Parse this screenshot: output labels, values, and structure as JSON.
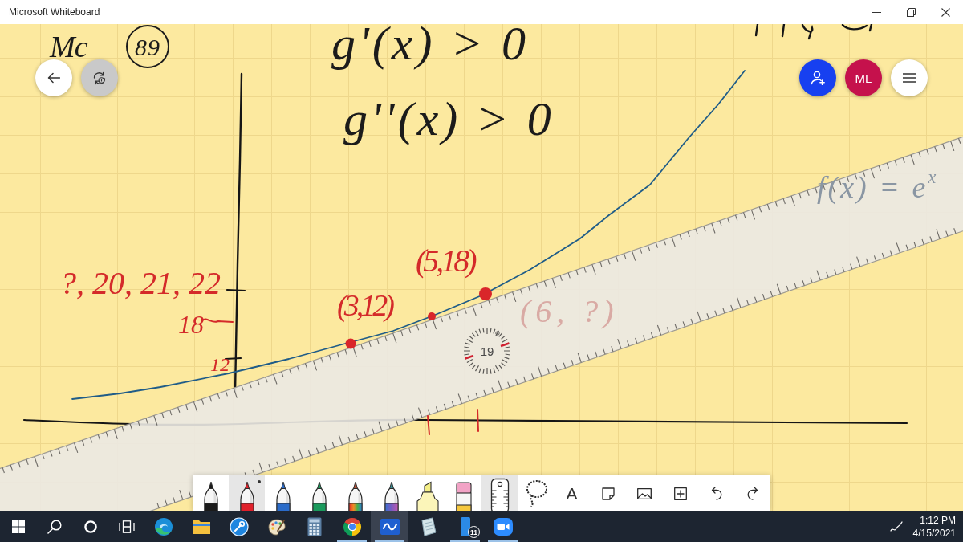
{
  "window": {
    "title": "Microsoft Whiteboard"
  },
  "board": {
    "ink_texts": [
      {
        "text": "Mc",
        "color": "#1b1b1b",
        "circled": false
      },
      {
        "text": "89",
        "color": "#1b1b1b",
        "circled": true
      },
      {
        "text": "g'(x) > 0",
        "color": "#1b1b1b",
        "circled": false
      },
      {
        "text": "g''(x) > 0",
        "color": "#1b1b1b",
        "circled": false
      },
      {
        "text": "f(x) = e$^{x}$",
        "color": "#8a96a3",
        "circled": false
      },
      {
        "text": "(5,18)",
        "color": "#d42a2a",
        "circled": false
      },
      {
        "text": "?, 20, 21, 22",
        "color": "#d42a2a",
        "circled": false
      },
      {
        "text": "18",
        "color": "#d42a2a",
        "circled": false
      },
      {
        "text": "(3,12)",
        "color": "#d42a2a",
        "circled": false
      },
      {
        "text": "(6, ?)",
        "color": "#d9aaa4",
        "circled": false
      },
      {
        "text": "12",
        "color": "#d42a2a",
        "circled": false
      }
    ],
    "angle_reading": "19",
    "participants": [
      {
        "initials": "ML",
        "color": "#c5114c"
      }
    ]
  },
  "toolbar": {
    "tools": [
      {
        "kind": "pen",
        "color": "#1b1b1b",
        "selected": false
      },
      {
        "kind": "pen",
        "color": "#e0212b",
        "selected": true
      },
      {
        "kind": "pen",
        "color": "#2a6bc9",
        "selected": false
      },
      {
        "kind": "pen",
        "color": "#1a9a5c",
        "selected": false
      },
      {
        "kind": "rainbow_pen",
        "selected": false
      },
      {
        "kind": "galaxy_pen",
        "selected": false
      },
      {
        "kind": "highlighter",
        "selected": false
      },
      {
        "kind": "eraser",
        "selected": false
      },
      {
        "kind": "ruler",
        "selected": true
      },
      {
        "kind": "lasso",
        "selected": false
      },
      {
        "kind": "text",
        "glyph": "A",
        "selected": false
      },
      {
        "kind": "sticky_note",
        "selected": false
      },
      {
        "kind": "image",
        "selected": false
      },
      {
        "kind": "insert",
        "selected": false
      },
      {
        "kind": "undo",
        "selected": false
      },
      {
        "kind": "redo",
        "selected": false
      }
    ]
  },
  "taskbar": {
    "apps": [
      {
        "kind": "start",
        "running": false,
        "selected": false
      },
      {
        "kind": "search",
        "running": false,
        "selected": false
      },
      {
        "kind": "cortana",
        "running": false,
        "selected": false
      },
      {
        "kind": "task_view",
        "running": false,
        "selected": false
      },
      {
        "kind": "edge",
        "running": false,
        "selected": false
      },
      {
        "kind": "file_explorer",
        "running": false,
        "selected": false
      },
      {
        "kind": "tool",
        "running": false,
        "selected": false
      },
      {
        "kind": "paint",
        "running": false,
        "selected": false
      },
      {
        "kind": "calculator",
        "running": false,
        "selected": false
      },
      {
        "kind": "chrome",
        "running": true,
        "selected": false
      },
      {
        "kind": "whiteboard",
        "running": true,
        "selected": true
      },
      {
        "kind": "note",
        "running": false,
        "selected": false
      },
      {
        "kind": "phone",
        "running": true,
        "selected": false,
        "badge": "11"
      },
      {
        "kind": "zoom",
        "running": true,
        "selected": false
      }
    ],
    "clock": {
      "time": "1:12 PM",
      "date": "4/15/2021"
    }
  }
}
